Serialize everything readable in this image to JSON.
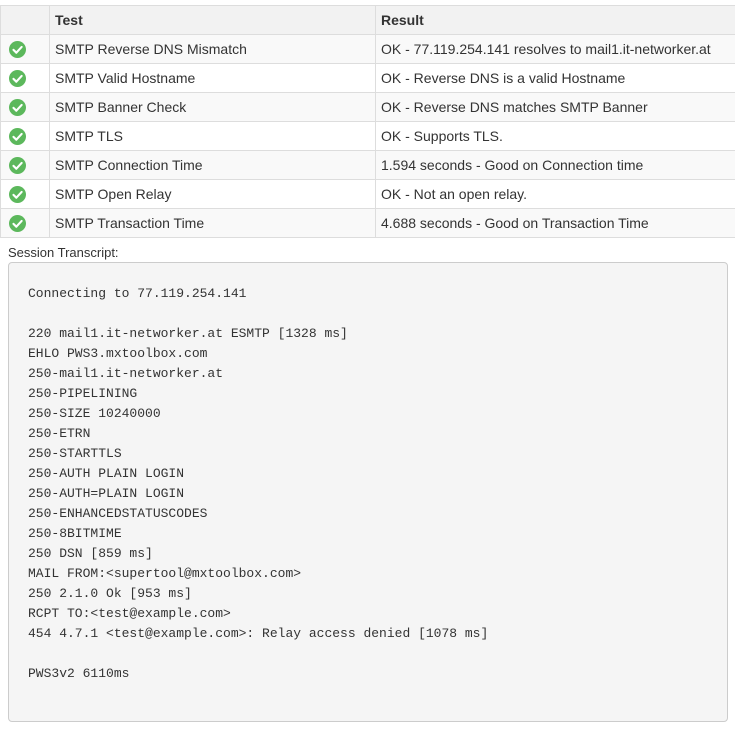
{
  "table": {
    "headers": {
      "status": "",
      "test": "Test",
      "result": "Result"
    },
    "rows": [
      {
        "status": "ok",
        "test": "SMTP Reverse DNS Mismatch",
        "result": "OK - 77.119.254.141 resolves to mail1.it-networker.at"
      },
      {
        "status": "ok",
        "test": "SMTP Valid Hostname",
        "result": "OK - Reverse DNS is a valid Hostname"
      },
      {
        "status": "ok",
        "test": "SMTP Banner Check",
        "result": "OK - Reverse DNS matches SMTP Banner"
      },
      {
        "status": "ok",
        "test": "SMTP TLS",
        "result": "OK - Supports TLS."
      },
      {
        "status": "ok",
        "test": "SMTP Connection Time",
        "result": "1.594 seconds - Good on Connection time"
      },
      {
        "status": "ok",
        "test": "SMTP Open Relay",
        "result": "OK - Not an open relay."
      },
      {
        "status": "ok",
        "test": "SMTP Transaction Time",
        "result": "4.688 seconds - Good on Transaction Time"
      }
    ]
  },
  "transcript": {
    "label": "Session Transcript:",
    "lines": [
      "Connecting to 77.119.254.141",
      "",
      "220 mail1.it-networker.at ESMTP [1328 ms]",
      "EHLO PWS3.mxtoolbox.com",
      "250-mail1.it-networker.at",
      "250-PIPELINING",
      "250-SIZE 10240000",
      "250-ETRN",
      "250-STARTTLS",
      "250-AUTH PLAIN LOGIN",
      "250-AUTH=PLAIN LOGIN",
      "250-ENHANCEDSTATUSCODES",
      "250-8BITMIME",
      "250 DSN [859 ms]",
      "MAIL FROM:<supertool@mxtoolbox.com>",
      "250 2.1.0 Ok [953 ms]",
      "RCPT TO:<test@example.com>",
      "454 4.7.1 <test@example.com>: Relay access denied [1078 ms]",
      "",
      "PWS3v2 6110ms"
    ]
  },
  "icons": {
    "status_ok": "check-circle-icon"
  },
  "colors": {
    "ok_green": "#5cb85c",
    "header_bg": "#f2f2f2",
    "border": "#dddddd",
    "transcript_bg": "#f5f5f5"
  }
}
